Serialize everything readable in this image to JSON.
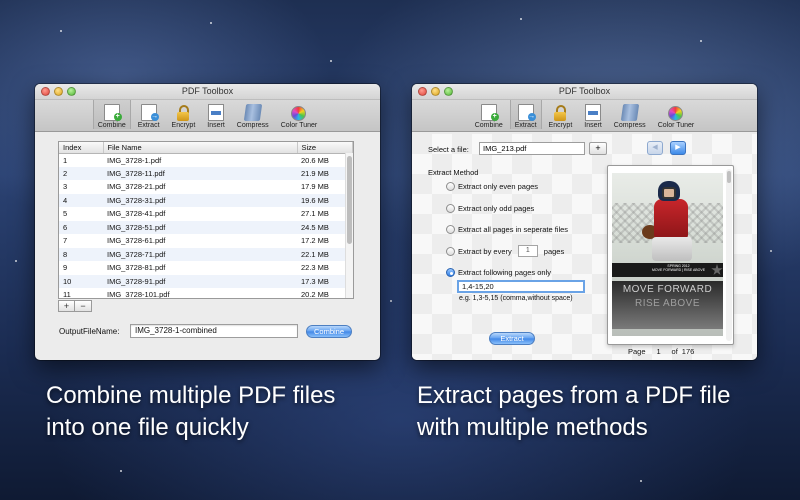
{
  "left_window": {
    "title": "PDF Toolbox",
    "toolbar": [
      {
        "label": "Combine",
        "icon": "combine-icon",
        "active": true
      },
      {
        "label": "Extract",
        "icon": "extract-icon",
        "active": false
      },
      {
        "label": "Encrypt",
        "icon": "lock-icon",
        "active": false
      },
      {
        "label": "Insert",
        "icon": "insert-icon",
        "active": false
      },
      {
        "label": "Compress",
        "icon": "compress-icon",
        "active": false
      },
      {
        "label": "Color Tuner",
        "icon": "color-wheel-icon",
        "active": false
      }
    ],
    "table": {
      "headers": {
        "index": "Index",
        "name": "File Name",
        "size": "Size"
      },
      "rows": [
        {
          "index": "1",
          "name": "IMG_3728-1.pdf",
          "size": "20.6 MB"
        },
        {
          "index": "2",
          "name": "IMG_3728-11.pdf",
          "size": "21.9 MB"
        },
        {
          "index": "3",
          "name": "IMG_3728-21.pdf",
          "size": "17.9 MB"
        },
        {
          "index": "4",
          "name": "IMG_3728-31.pdf",
          "size": "19.6 MB"
        },
        {
          "index": "5",
          "name": "IMG_3728-41.pdf",
          "size": "27.1 MB"
        },
        {
          "index": "6",
          "name": "IMG_3728-51.pdf",
          "size": "24.5 MB"
        },
        {
          "index": "7",
          "name": "IMG_3728-61.pdf",
          "size": "17.2 MB"
        },
        {
          "index": "8",
          "name": "IMG_3728-71.pdf",
          "size": "22.1 MB"
        },
        {
          "index": "9",
          "name": "IMG_3728-81.pdf",
          "size": "22.3 MB"
        },
        {
          "index": "10",
          "name": "IMG_3728-91.pdf",
          "size": "17.3 MB"
        },
        {
          "index": "11",
          "name": "IMG_3728-101.pdf",
          "size": "20.2 MB"
        }
      ]
    },
    "add_label": "+",
    "remove_label": "−",
    "output_label": "OutputFileName:",
    "output_value": "IMG_3728-1-combined",
    "combine_button": "Combine"
  },
  "right_window": {
    "title": "PDF Toolbox",
    "toolbar": [
      {
        "label": "Combine",
        "icon": "combine-icon",
        "active": false
      },
      {
        "label": "Extract",
        "icon": "extract-icon",
        "active": true
      },
      {
        "label": "Encrypt",
        "icon": "lock-icon",
        "active": false
      },
      {
        "label": "Insert",
        "icon": "insert-icon",
        "active": false
      },
      {
        "label": "Compress",
        "icon": "compress-icon",
        "active": false
      },
      {
        "label": "Color Tuner",
        "icon": "color-wheel-icon",
        "active": false
      }
    ],
    "select_label": "Select a file:",
    "select_value": "IMG_213.pdf",
    "add_label": "+",
    "method_label": "Extract Method",
    "methods": {
      "even": "Extract only even pages",
      "odd": "Extract only odd pages",
      "separate": "Extract all pages in seperate files",
      "every_prefix": "Extract by every",
      "every_value": "1",
      "every_suffix": "pages",
      "following": "Extract following pages only"
    },
    "pages_value": "1,4-15,20",
    "pages_hint": "e.g. 1,3-5,15 (comma,without space)",
    "extract_button": "Extract",
    "preview": {
      "banner_top": "SPRING 2012",
      "banner_bottom": "MOVE FORWARD | RISE ABOVE",
      "line1": "MOVE FORWARD",
      "line2": "RISE ABOVE"
    },
    "page": {
      "label": "Page",
      "current": "1",
      "of": "of",
      "total": "176"
    }
  },
  "captions": {
    "left_1": "Combine multiple PDF files",
    "left_2": "into one file quickly",
    "right_1": "Extract pages from a PDF file",
    "right_2": "with multiple methods"
  },
  "colors": {
    "accent": "#3f86e6",
    "selected_radio": "#2d7de6"
  }
}
